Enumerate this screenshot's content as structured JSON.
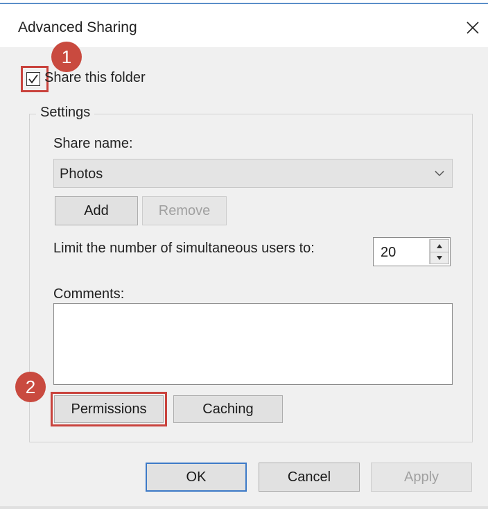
{
  "window": {
    "title": "Advanced Sharing",
    "close_icon": "close-icon"
  },
  "share": {
    "checkbox_label": "Share this folder",
    "checked": true
  },
  "settings": {
    "group_title": "Settings",
    "share_name_label": "Share name:",
    "share_name_value": "Photos",
    "add_label": "Add",
    "remove_label": "Remove",
    "limit_label": "Limit the number of simultaneous users to:",
    "limit_value": "20",
    "comments_label": "Comments:",
    "comments_value": "",
    "permissions_label": "Permissions",
    "caching_label": "Caching"
  },
  "annotations": {
    "step1": "1",
    "step2": "2",
    "accent_color": "#c94a3f"
  },
  "footer": {
    "ok_label": "OK",
    "cancel_label": "Cancel",
    "apply_label": "Apply"
  }
}
